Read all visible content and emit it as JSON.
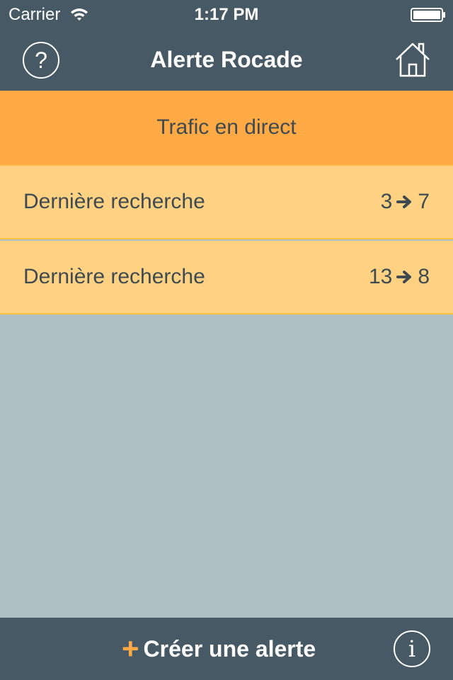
{
  "status_bar": {
    "carrier": "Carrier",
    "time": "1:17 PM",
    "wifi_icon": "wifi-icon",
    "battery_icon": "battery-icon"
  },
  "nav_bar": {
    "title": "Alerte Rocade",
    "help_label": "?",
    "home_icon": "home-icon"
  },
  "live_traffic": {
    "label": "Trafic en direct"
  },
  "recent_searches": [
    {
      "label": "Dernière recherche",
      "from": "3",
      "to": "7"
    },
    {
      "label": "Dernière recherche",
      "from": "13",
      "to": "8"
    }
  ],
  "tab_bar": {
    "plus": "+",
    "create_label": "Créer une alerte",
    "info_label": "i"
  },
  "colors": {
    "header_bg": "#465964",
    "accent_orange": "#FFAA44",
    "row_bg": "#FFD283",
    "page_bg": "#B0BEC5",
    "text_dark": "#3E4A50"
  }
}
